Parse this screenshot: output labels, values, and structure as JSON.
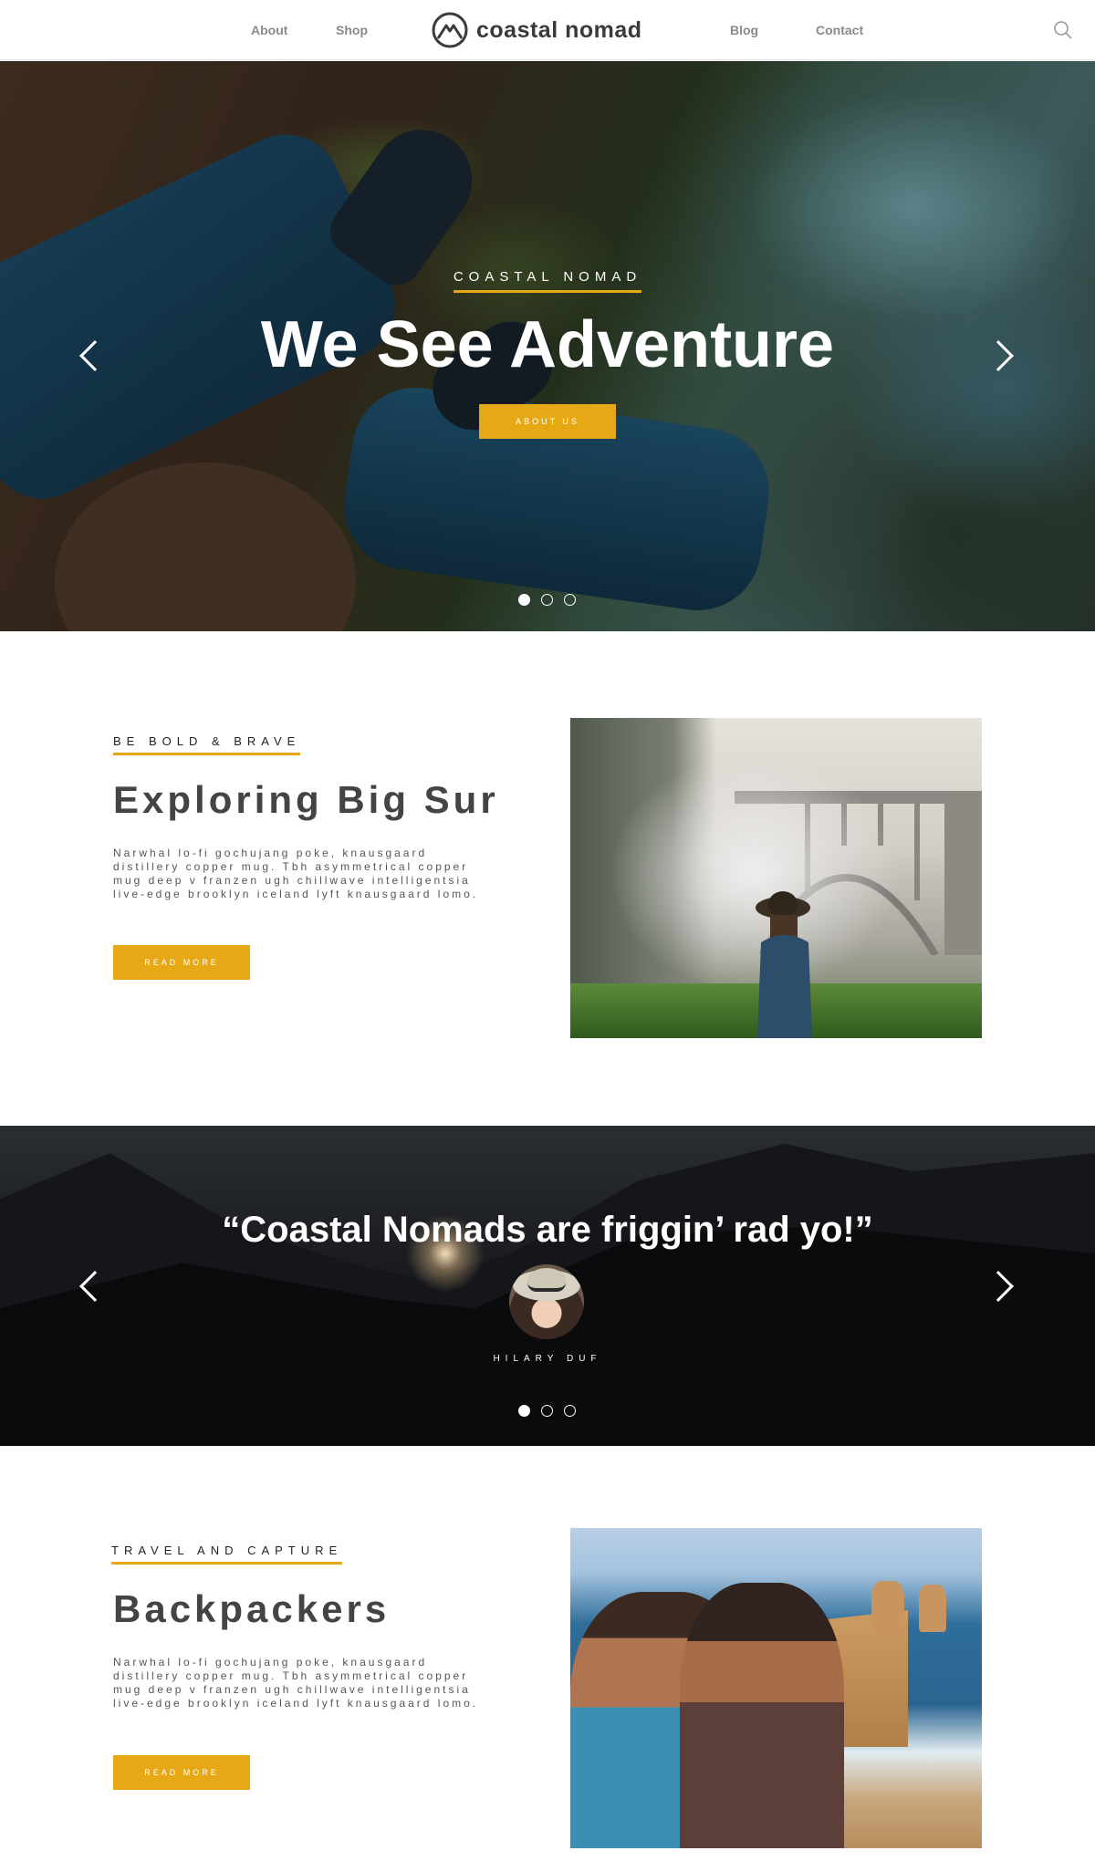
{
  "nav": {
    "links": [
      "About",
      "Shop",
      "Blog",
      "Contact"
    ],
    "logo_text": "coastal nomad",
    "search_icon": "search-icon"
  },
  "hero": {
    "kicker": "COASTAL NOMAD",
    "title": "We See Adventure",
    "button": "ABOUT US",
    "slides": 3,
    "active_slide": 1
  },
  "feature1": {
    "kicker": "BE BOLD & BRAVE",
    "heading": "Exploring Big Sur",
    "body": "Narwhal lo-fi gochujang poke, knausgaard distillery copper mug. Tbh asymmetrical copper mug deep v franzen ugh chillwave intelligentsia live-edge brooklyn iceland lyft knausgaard lomo.",
    "button": "READ MORE"
  },
  "testimonial": {
    "quote": "“Coastal Nomads are friggin’ rad yo!”",
    "author": "HILARY DUF",
    "slides": 3,
    "active_slide": 1
  },
  "feature2": {
    "kicker": "TRAVEL AND CAPTURE",
    "heading": "Backpackers",
    "body": "Narwhal lo-fi gochujang poke, knausgaard distillery copper mug. Tbh asymmetrical copper mug deep v franzen ugh chillwave intelligentsia live-edge brooklyn iceland lyft knausgaard lomo.",
    "button": "READ MORE"
  },
  "colors": {
    "accent": "#e6a915",
    "heading": "#444444",
    "nav_text": "#8a8a8a"
  }
}
